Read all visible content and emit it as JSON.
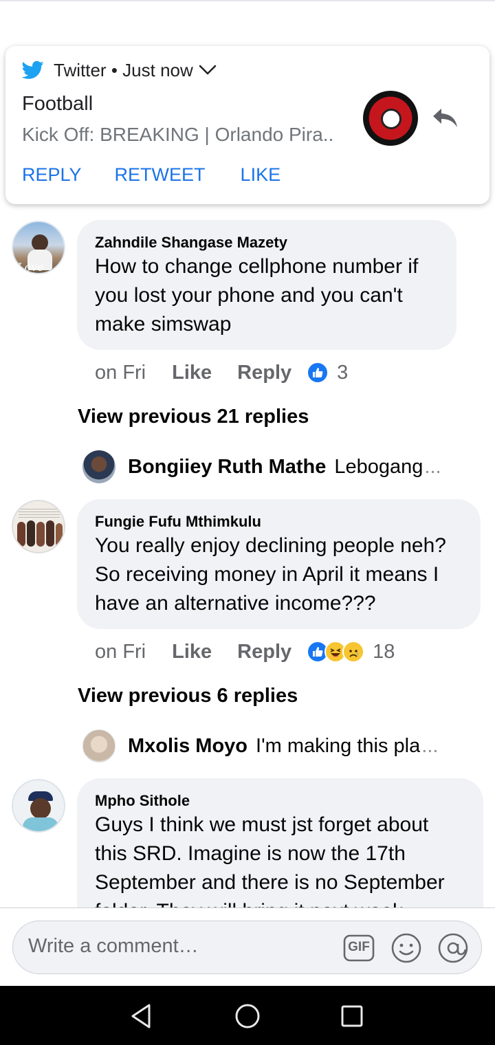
{
  "notification": {
    "app_name": "Twitter",
    "separator": "•",
    "time": "Just now",
    "title": "Football",
    "text": "Kick Off: BREAKING | Orlando Pira..",
    "actions": [
      "REPLY",
      "RETWEET",
      "LIKE"
    ]
  },
  "comments": [
    {
      "author": "Zahndile Shangase Mazety",
      "lines": [
        "How to change cellphone number if",
        "you lost your phone and you can't",
        "make simswap"
      ],
      "time": "on Fri",
      "like_label": "Like",
      "reply_label": "Reply",
      "reaction_count": "3",
      "view_previous": "View previous 21 replies",
      "latest_reply": {
        "author": "Bongiiey Ruth Mathe",
        "text": "Lebogang",
        "ellipsis": "..."
      }
    },
    {
      "author": "Fungie Fufu Mthimkulu",
      "lines": [
        "You really enjoy declining people neh?",
        "So receiving money in April it means I",
        "have an alternative income???"
      ],
      "time": "on Fri",
      "like_label": "Like",
      "reply_label": "Reply",
      "reaction_count": "18",
      "view_previous": "View previous 6 replies",
      "latest_reply": {
        "author": "Mxolis Moyo",
        "text": "I'm making this pla",
        "ellipsis": "..."
      }
    },
    {
      "author": "Mpho Sithole",
      "lines": [
        "Guys I think we must jst forget about",
        "this SRD. Imagine is now the 17th",
        "September and there is no September",
        "folder. They will bring it next week"
      ]
    }
  ],
  "composer": {
    "placeholder": "Write a comment…",
    "gif_label": "GIF"
  },
  "colors": {
    "facebook_blue": "#1877f2",
    "twitter_blue": "#1da1f2",
    "bubble_bg": "#f0f2f5",
    "secondary_text": "#65676b"
  }
}
